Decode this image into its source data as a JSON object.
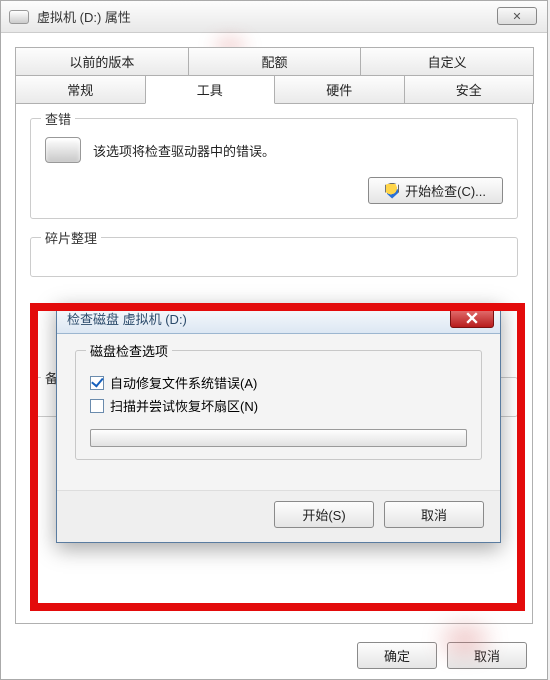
{
  "window": {
    "title": "虚拟机 (D:) 属性",
    "close_glyph": "✕"
  },
  "tabs_top": [
    "以前的版本",
    "配额",
    "自定义"
  ],
  "tabs_bottom": [
    "常规",
    "工具",
    "硬件",
    "安全"
  ],
  "active_tab_index": 1,
  "group_check": {
    "legend": "查错",
    "description": "该选项将检查驱动器中的错误。",
    "button": "开始检查(C)..."
  },
  "group_defrag": {
    "legend": "碎片整理"
  },
  "group_backup": {
    "legend": "备"
  },
  "modal": {
    "title": "检查磁盘 虚拟机 (D:)",
    "group_legend": "磁盘检查选项",
    "option_autofix": {
      "label": "自动修复文件系统错误(A)",
      "checked": true
    },
    "option_scanbad": {
      "label": "扫描并尝试恢复坏扇区(N)",
      "checked": false
    },
    "start_button": "开始(S)",
    "cancel_button": "取消"
  },
  "main_buttons": {
    "ok": "确定",
    "cancel": "取消"
  }
}
